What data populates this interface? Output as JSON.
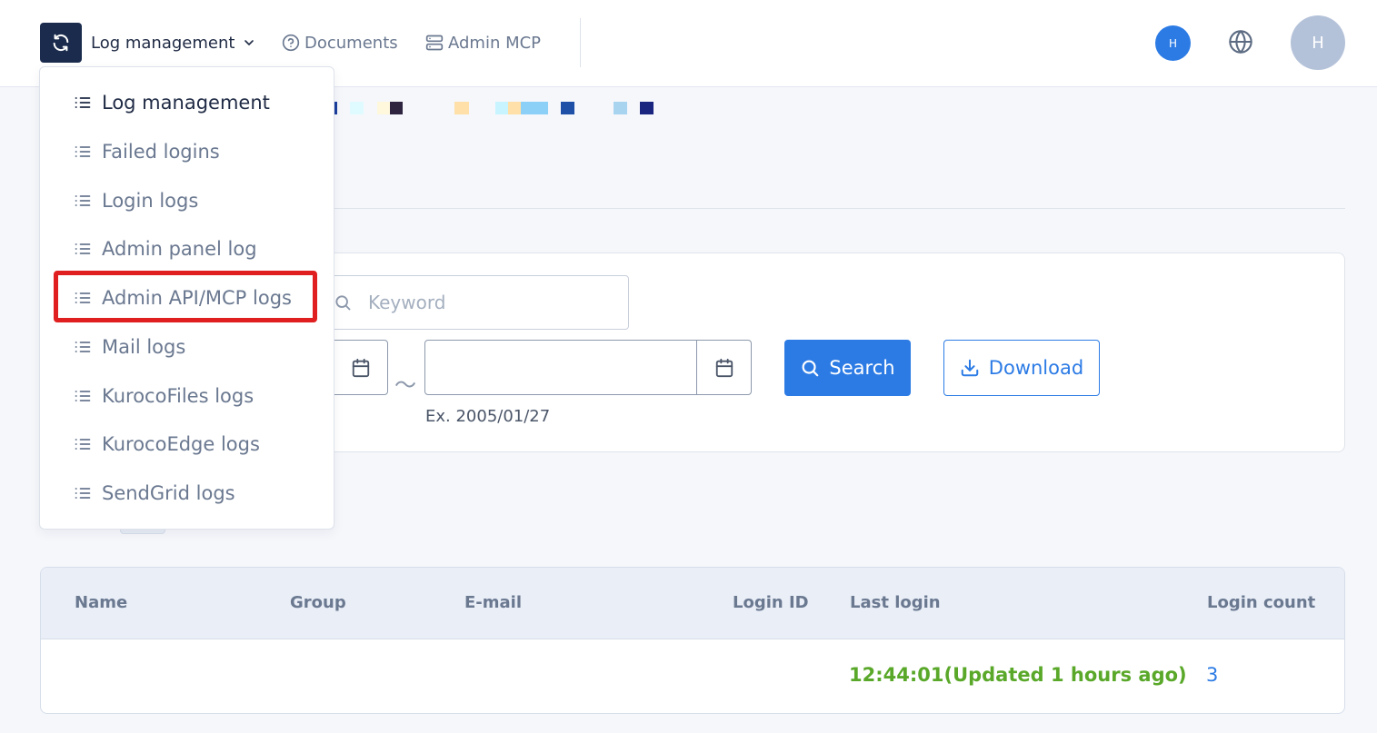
{
  "header": {
    "app_menu_label": "Log management",
    "documents_label": "Documents",
    "admin_mcp_label": "Admin MCP",
    "mini_avatar_initial": "H",
    "avatar_initial": "H"
  },
  "dropdown": {
    "items": [
      {
        "label": "Log management"
      },
      {
        "label": "Failed logins"
      },
      {
        "label": "Login logs"
      },
      {
        "label": "Admin panel log"
      },
      {
        "label": "Admin API/MCP logs"
      },
      {
        "label": "Mail logs"
      },
      {
        "label": "KurocoFiles logs"
      },
      {
        "label": "KurocoEdge logs"
      },
      {
        "label": "SendGrid logs"
      }
    ],
    "highlighted_index": 4
  },
  "search": {
    "keyword_placeholder": "Keyword",
    "date_separator": "～",
    "date_hint": "Ex. 2005/01/27",
    "search_label": "Search",
    "download_label": "Download"
  },
  "table": {
    "columns": [
      "Name",
      "Group",
      "E-mail",
      "Login ID",
      "Last login",
      "Login count"
    ],
    "rows": [
      {
        "last_login": "12:44:01(Updated 1 hours ago)",
        "login_count": "3"
      }
    ]
  },
  "colors": {
    "primary": "#2c7be5",
    "navy": "#1a2b4d",
    "success_text": "#5aa82a",
    "highlight": "#e02020"
  }
}
